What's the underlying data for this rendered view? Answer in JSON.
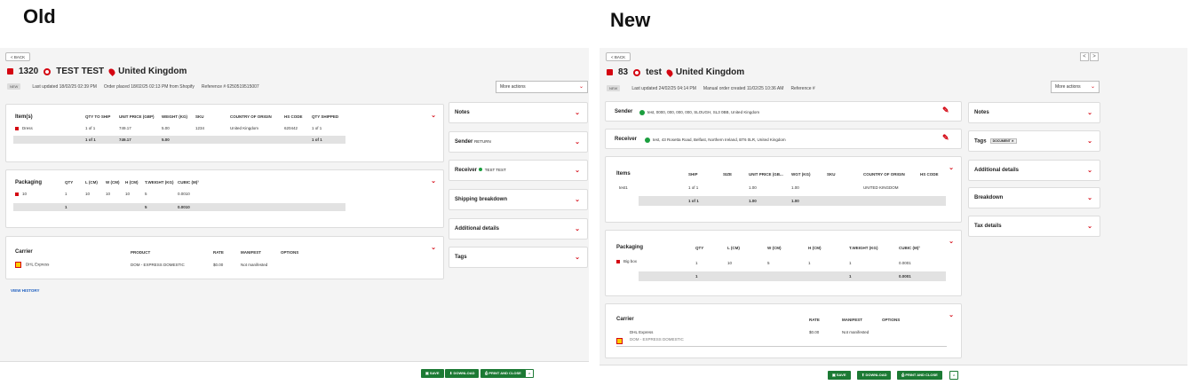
{
  "headings": {
    "old": "Old",
    "new": "New"
  },
  "old": {
    "back_label": "< BACK",
    "order_id": "1320",
    "customer": "TEST TEST",
    "country": "United Kingdom",
    "status": "NEW",
    "last_updated": "Last updated 18/02/25 02:39 PM",
    "order_placed": "Order placed 18/02/25 02:13 PM from Shopify",
    "reference": "Reference # 6250519515007",
    "more_actions": "More actions",
    "items": {
      "title": "Item(s)",
      "headers": [
        "QTY TO SHIP",
        "UNIT PRICE (GBP)",
        "WEIGHT (KG)",
        "SKU",
        "COUNTRY OF ORIGIN",
        "HS CODE",
        "QTY SHIPPED"
      ],
      "row": {
        "name": "Dress",
        "qty": "1 of 1",
        "price": "749.17",
        "weight": "5.00",
        "sku": "1234",
        "origin": "United Kingdom",
        "hs": "620442",
        "shipped": "1 of 1"
      },
      "total": {
        "qty": "1 of 1",
        "price": "749.17",
        "weight": "5.00",
        "shipped": "1 of 1"
      }
    },
    "packaging": {
      "title": "Packaging",
      "headers": [
        "QTY",
        "L (CM)",
        "W (CM)",
        "H (CM)",
        "T.WEIGHT (KG)",
        "CUBIC (M)³"
      ],
      "row": {
        "name": "10",
        "qty": "1",
        "l": "10",
        "w": "10",
        "h": "10",
        "tw": "5",
        "cubic": "0.0010"
      },
      "total": {
        "qty": "1",
        "tw": "5",
        "cubic": "0.0010"
      }
    },
    "carrier": {
      "title": "Carrier",
      "headers": [
        "PRODUCT",
        "RATE",
        "MANIFEST",
        "OPTIONS"
      ],
      "name": "DHL Express",
      "product": "DOM - EXPRESS DOMESTIC",
      "rate": "$0.00",
      "manifest": "Not manifested"
    },
    "view_history": "VIEW HISTORY",
    "side": {
      "notes": "Notes",
      "sender": "Sender",
      "sender_value": "RETURN",
      "receiver": "Receiver",
      "receiver_value": "TEST TEST",
      "shipping": "Shipping breakdown",
      "additional": "Additional details",
      "tags": "Tags"
    },
    "footer": {
      "save": "SAVE",
      "download": "DOWNLOAD",
      "print": "PRINT AND CLOSE",
      "more": "^"
    }
  },
  "new": {
    "back_label": "< BACK",
    "order_id": "83",
    "customer": "test",
    "country": "United Kingdom",
    "status": "NEW",
    "last_updated": "Last updated 24/02/25 04:14 PM",
    "order_created": "Manual order created 11/02/25 10:36 AM",
    "reference": "Reference #",
    "more_actions": "More actions",
    "nav_prev": "<",
    "nav_next": ">",
    "sender": {
      "label": "Sender",
      "value": "test,  0000,  000,  000,  000,  SLOUGH,  SL3 0BB,  United Kingdom"
    },
    "receiver": {
      "label": "Receiver",
      "value": "test,  43 Rosetta Road,  Belfast,  Northern Ireland,  BT6 0LR,  United Kingdom"
    },
    "items": {
      "title": "Items",
      "headers": [
        "SHIP",
        "SIZE",
        "UNIT PRICE (GB...",
        "WGT (KG)",
        "SKU",
        "COUNTRY OF ORIGIN",
        "HS CODE"
      ],
      "row": {
        "name": "test1",
        "ship": "1 of 1",
        "price": "1.00",
        "weight": "1.00",
        "origin": "UNITED KINGDOM"
      },
      "total": {
        "ship": "1 of 1",
        "price": "1.00",
        "weight": "1.00"
      }
    },
    "packaging": {
      "title": "Packaging",
      "headers": [
        "QTY",
        "L (CM)",
        "W (CM)",
        "H (CM)",
        "T.WEIGHT (KG)",
        "CUBIC (M)³"
      ],
      "row": {
        "name": "Big box",
        "qty": "1",
        "l": "10",
        "w": "5",
        "h": "1",
        "tw": "1",
        "cubic": "0.0001"
      },
      "total": {
        "qty": "1",
        "tw": "1",
        "cubic": "0.0001"
      }
    },
    "carrier": {
      "title": "Carrier",
      "headers": [
        "RATE",
        "MANIFEST",
        "OPTIONS"
      ],
      "name": "DHL Express",
      "product": "DOM - EXPRESS DOMESTIC",
      "rate": "$0.00",
      "manifest": "Not manifested"
    },
    "side": {
      "notes": "Notes",
      "tags": "Tags",
      "tag_chip": "DOCUMENT ✕",
      "additional": "Additional details",
      "breakdown": "Breakdown",
      "tax": "Tax details"
    },
    "footer": {
      "save": "SAVE",
      "download": "DOWNLOAD",
      "print": "PRINT AND CLOSE",
      "more": "^"
    }
  }
}
